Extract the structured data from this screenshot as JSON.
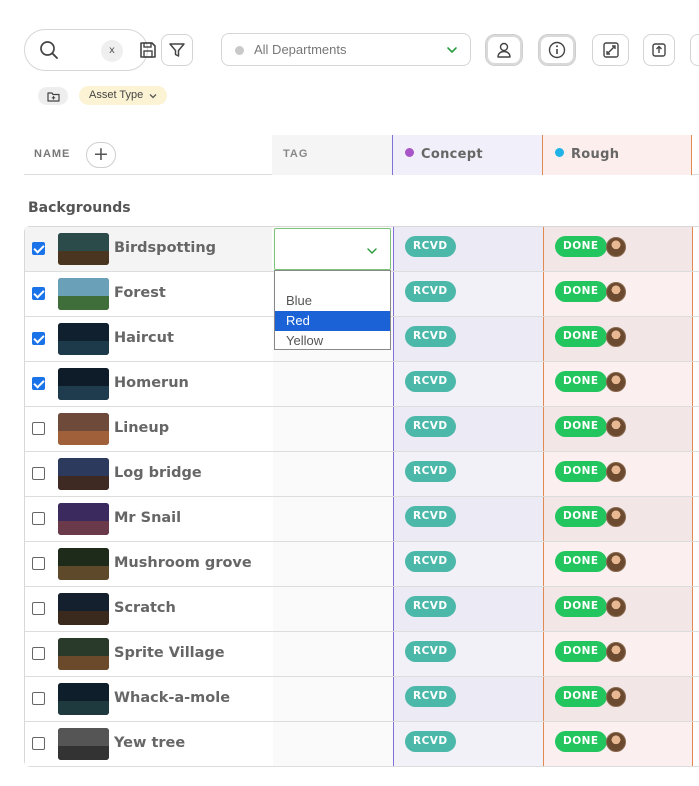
{
  "toolbar": {
    "search_clear_label": "x",
    "department_select": {
      "value": "All Departments"
    },
    "icons": [
      "search-icon",
      "save-icon",
      "filter-icon",
      "person-icon",
      "info-icon",
      "expand-icon",
      "upload-icon"
    ]
  },
  "filters": {
    "asset_type_label": "Asset Type"
  },
  "table": {
    "columns": {
      "name": "NAME",
      "add_column": "+",
      "tag": "TAG",
      "stages": [
        {
          "label": "Concept",
          "dot_color": "#a855c7"
        },
        {
          "label": "Rough",
          "dot_color": "#1eb3e6"
        }
      ]
    },
    "group": {
      "title": "Backgrounds",
      "rows": [
        {
          "name": "Birdspotting",
          "checked": true,
          "concept": "RCVD",
          "rough": "DONE"
        },
        {
          "name": "Forest",
          "checked": true,
          "concept": "RCVD",
          "rough": "DONE"
        },
        {
          "name": "Haircut",
          "checked": true,
          "concept": "RCVD",
          "rough": "DONE"
        },
        {
          "name": "Homerun",
          "checked": true,
          "concept": "RCVD",
          "rough": "DONE"
        },
        {
          "name": "Lineup",
          "checked": false,
          "concept": "RCVD",
          "rough": "DONE"
        },
        {
          "name": "Log bridge",
          "checked": false,
          "concept": "RCVD",
          "rough": "DONE"
        },
        {
          "name": "Mr Snail",
          "checked": false,
          "concept": "RCVD",
          "rough": "DONE"
        },
        {
          "name": "Mushroom grove",
          "checked": false,
          "concept": "RCVD",
          "rough": "DONE"
        },
        {
          "name": "Scratch",
          "checked": false,
          "concept": "RCVD",
          "rough": "DONE"
        },
        {
          "name": "Sprite Village",
          "checked": false,
          "concept": "RCVD",
          "rough": "DONE"
        },
        {
          "name": "Whack-a-mole",
          "checked": false,
          "concept": "RCVD",
          "rough": "DONE"
        },
        {
          "name": "Yew tree",
          "checked": false,
          "concept": "RCVD",
          "rough": "DONE"
        }
      ]
    }
  },
  "tag_dropdown": {
    "value": "",
    "options": [
      "",
      "Blue",
      "Red",
      "Yellow"
    ],
    "highlighted": "Red"
  },
  "colors": {
    "accent": "#1a73e8",
    "rcvd": "#4cb8a9",
    "done": "#22c55e",
    "concept_border": "#7e72d6",
    "rough_border": "#e08a52"
  }
}
